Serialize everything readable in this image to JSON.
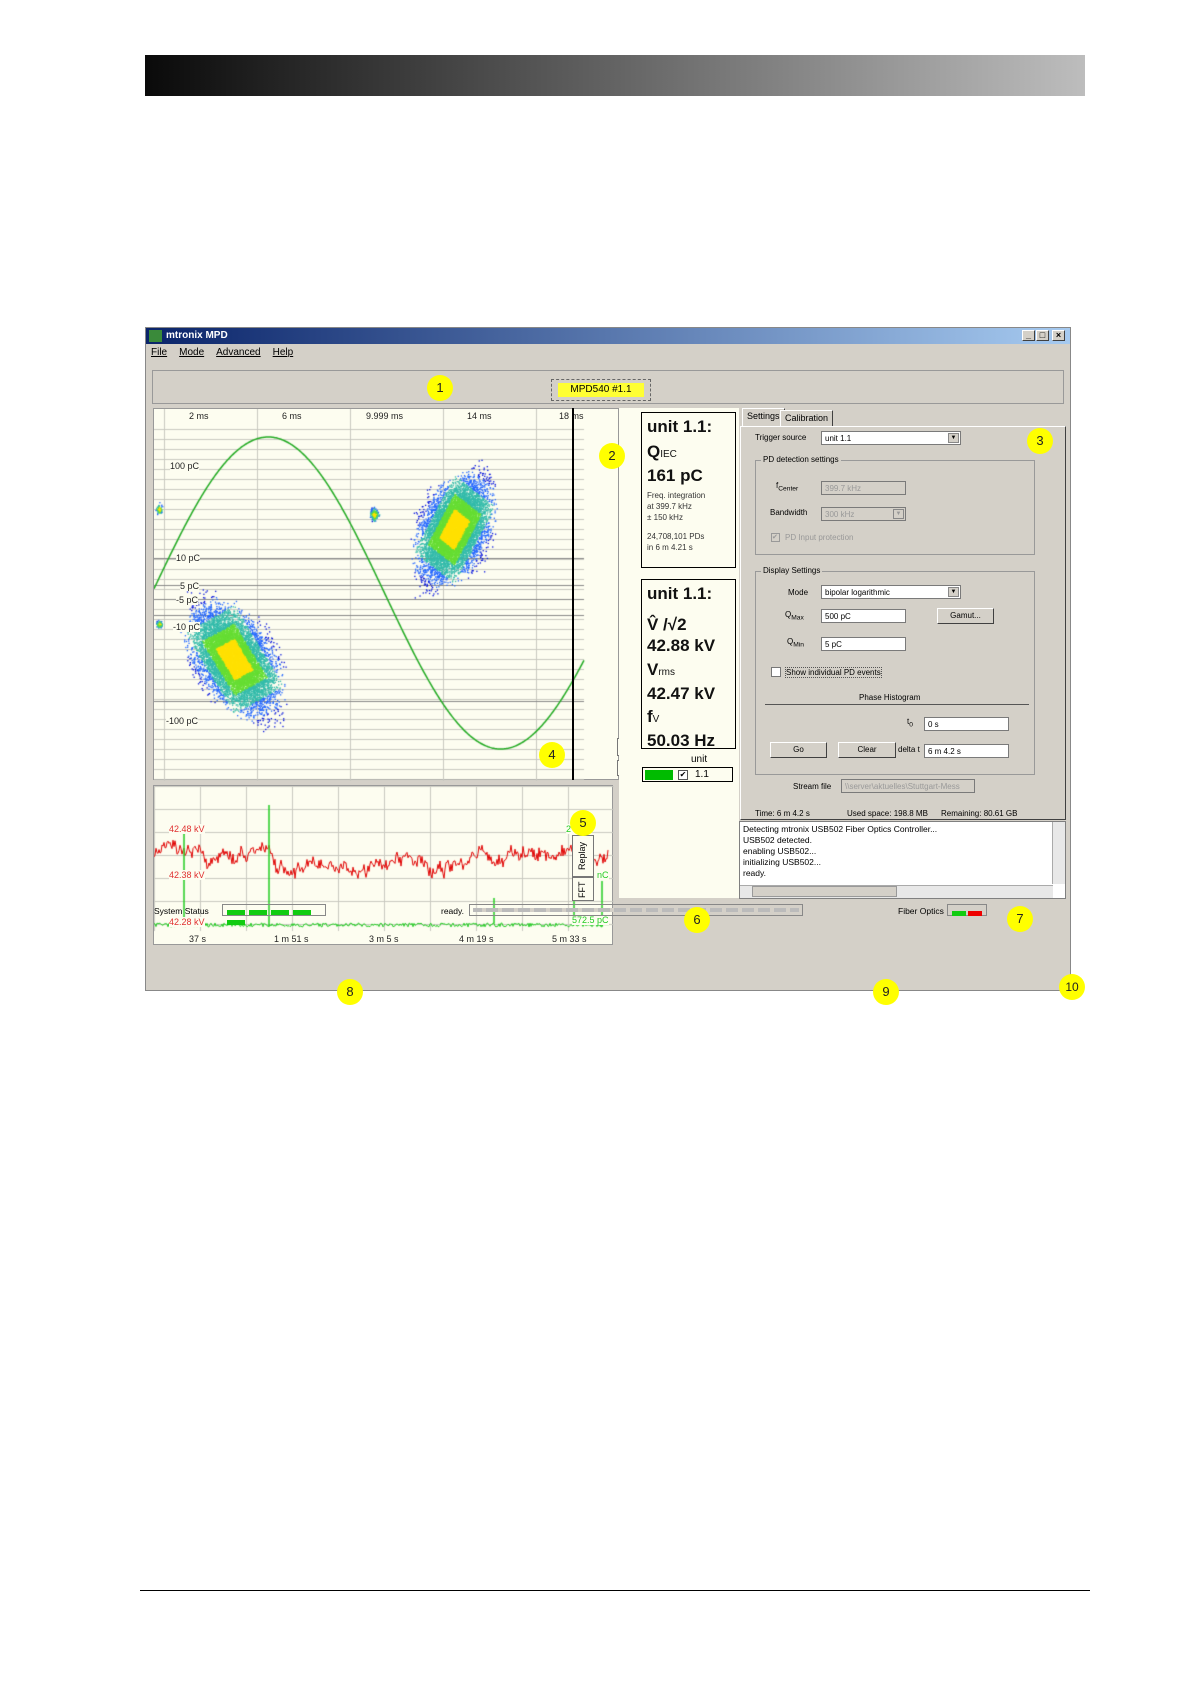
{
  "window": {
    "title": "mtronix MPD",
    "menu": [
      "File",
      "Mode",
      "Advanced",
      "Help"
    ],
    "device_tag": "MPD540 #1.1"
  },
  "prpd": {
    "x_ticks": [
      "2 ms",
      "6 ms",
      "9.999 ms",
      "14 ms",
      "18 ms"
    ],
    "y_labels": [
      "100 pC",
      "10 pC",
      "5 pC",
      "-5 pC",
      "-10 pC",
      "-100 pC"
    ],
    "scale_top": "25",
    "scale_bottom": "1"
  },
  "info1": {
    "title": "unit 1.1:",
    "q": "Q",
    "q_sub": "IEC",
    "value": "161 pC",
    "note1": "Freq. integration",
    "note2": "at 399.7 kHz",
    "note3": "± 150 kHz",
    "count": "24,708,101 PDs",
    "duration": "in  6 m 4.21 s"
  },
  "info2": {
    "title": "unit 1.1:",
    "v_label": "V̂ /√2",
    "v_value": "42.88 kV",
    "vrms_label": "V",
    "vrms_sub": "rms",
    "vrms_value": "42.47 kV",
    "f_label": "f",
    "f_sub": "V",
    "f_value": "50.03 Hz"
  },
  "legend": {
    "header": "unit",
    "unit": "1.1",
    "checked": true,
    "color": "#00bb00"
  },
  "trend": {
    "x_ticks": [
      "37 s",
      "1 m 51 s",
      "3 m 5 s",
      "4 m 19 s",
      "5 m 33 s"
    ],
    "red_labels": [
      "42.48 kV",
      "42.38 kV",
      "42.28 kV"
    ],
    "green_labels": [
      "2 nC",
      "1.672 nC",
      "572.5 pC"
    ],
    "tabs": [
      "Replay",
      "FFT"
    ],
    "voltage_color": "#e00000",
    "charge_color": "#22cc22"
  },
  "settings": {
    "tabs": [
      "Settings",
      "Calibration"
    ],
    "trigger_label": "Trigger source",
    "trigger_value": "unit 1.1",
    "pd_group": "PD detection settings",
    "fcenter_label": "f",
    "fcenter_sub": "Center",
    "fcenter_value": "399.7 kHz",
    "bandwidth_label": "Bandwidth",
    "bandwidth_value": "300 kHz",
    "protection_label": "PD Input protection",
    "display_group": "Display Settings",
    "mode_label": "Mode",
    "mode_value": "bipolar logarithmic",
    "qmax_label": "Q",
    "qmax_sub": "Max",
    "qmax_value": "500 pC",
    "gamut_button": "Gamut...",
    "qmin_label": "Q",
    "qmin_sub": "Min",
    "qmin_value": "5 pC",
    "show_events_label": "Show individual PD events",
    "phase_histogram": "Phase Histogram",
    "t0_label": "t",
    "t0_sub": "0",
    "t0_value": "0 s",
    "go_button": "Go",
    "clear_button": "Clear",
    "delta_label": "delta t",
    "delta_value": "6 m 4.2 s",
    "stream_label": "Stream file",
    "stream_value": "\\\\server\\aktuelles\\Stuttgart-Mess",
    "time": "Time:  6 m 4.2 s",
    "used": "Used space:  198.8 MB",
    "remaining": "Remaining:  80.61 GB"
  },
  "log": [
    "Detecting mtronix USB502 Fiber Optics Controller...",
    "USB502 detected.",
    "enabling USB502...",
    "initializing USB502...",
    "ready."
  ],
  "status": {
    "system_label": "System Status",
    "ready": "ready.",
    "fiber_label": "Fiber Optics"
  },
  "markers": [
    "1",
    "2",
    "3",
    "4",
    "5",
    "6",
    "7",
    "8",
    "9",
    "10"
  ]
}
